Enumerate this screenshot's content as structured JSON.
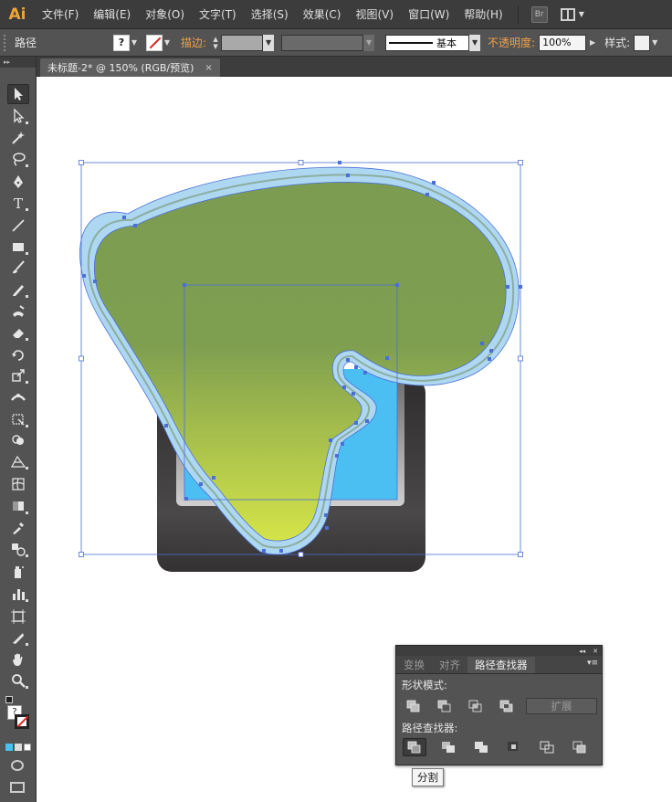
{
  "app": {
    "logo": "Ai",
    "accent_color": "#f2a23a"
  },
  "menu": {
    "items": [
      "文件(F)",
      "编辑(E)",
      "对象(O)",
      "文字(T)",
      "选择(S)",
      "效果(C)",
      "视图(V)",
      "窗口(W)",
      "帮助(H)"
    ],
    "bridge_label": "Br"
  },
  "control_bar": {
    "selection_type": "路径",
    "stroke_label": "描边:",
    "stroke_profile": "基本",
    "opacity_label": "不透明度:",
    "opacity_value": "100%",
    "style_label": "样式:",
    "fill_swatch": "?"
  },
  "document": {
    "tab_title": "未标题-2* @ 150% (RGB/预览)",
    "tab_close": "×"
  },
  "toolbox": {
    "tools": [
      "selection-tool",
      "direct-selection-tool",
      "magic-wand-tool",
      "lasso-tool",
      "pen-tool",
      "type-tool",
      "line-segment-tool",
      "rectangle-tool",
      "paintbrush-tool",
      "pencil-tool",
      "blob-brush-tool",
      "eraser-tool",
      "rotate-tool",
      "scale-tool",
      "width-tool",
      "free-transform-tool",
      "shape-builder-tool",
      "perspective-grid-tool",
      "mesh-tool",
      "gradient-tool",
      "eyedropper-tool",
      "blend-tool",
      "symbol-sprayer-tool",
      "column-graph-tool",
      "artboard-tool",
      "slice-tool",
      "hand-tool",
      "zoom-tool"
    ]
  },
  "pathfinder_panel": {
    "tabs": [
      "变换",
      "对齐",
      "路径查找器"
    ],
    "active_tab": "路径查找器",
    "shape_modes_label": "形状模式:",
    "pathfinders_label": "路径查找器:",
    "expand_label": "扩展",
    "tooltip": "分割"
  },
  "artwork_colors": {
    "shape_fill_top": "#7b9d52",
    "shape_fill_bottom": "#cde24a",
    "stroke_highlight": "#aed8f2",
    "screen_blue": "#4bbef2",
    "device_dark": "#3a3839",
    "selection_color": "#4a6fd6"
  }
}
